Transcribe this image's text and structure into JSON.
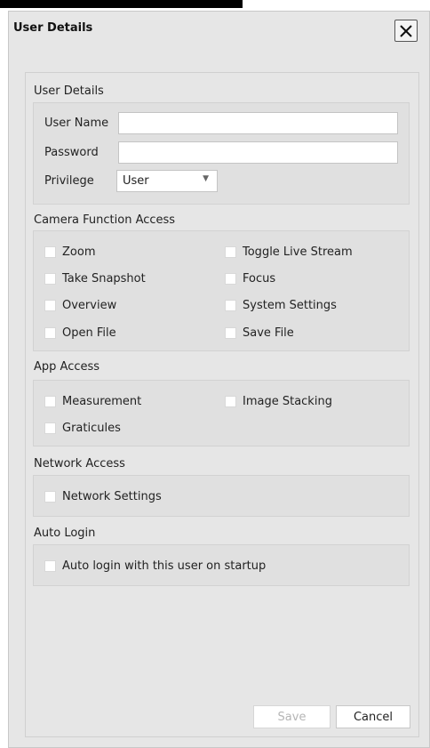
{
  "dialog": {
    "title": "User Details"
  },
  "user_details": {
    "section_label": "User Details",
    "username_label": "User Name",
    "username_value": "",
    "password_label": "Password",
    "password_value": "",
    "privilege_label": "Privilege",
    "privilege_value": "User"
  },
  "camera": {
    "section_label": "Camera Function Access",
    "items": [
      {
        "label": "Zoom",
        "checked": false
      },
      {
        "label": "Toggle Live Stream",
        "checked": false
      },
      {
        "label": "Take Snapshot",
        "checked": false
      },
      {
        "label": "Focus",
        "checked": false
      },
      {
        "label": "Overview",
        "checked": false
      },
      {
        "label": "System Settings",
        "checked": false
      },
      {
        "label": "Open File",
        "checked": false
      },
      {
        "label": "Save File",
        "checked": false
      }
    ]
  },
  "app": {
    "section_label": "App Access",
    "items": [
      {
        "label": "Measurement",
        "checked": false
      },
      {
        "label": "Image Stacking",
        "checked": false
      },
      {
        "label": "Graticules",
        "checked": false
      }
    ]
  },
  "network": {
    "section_label": "Network Access",
    "items": [
      {
        "label": "Network Settings",
        "checked": false
      }
    ]
  },
  "autologin": {
    "section_label": "Auto Login",
    "items": [
      {
        "label": "Auto login with this user on startup",
        "checked": false
      }
    ]
  },
  "buttons": {
    "save": "Save",
    "cancel": "Cancel"
  },
  "colors": {
    "dialog_bg": "#e6e6e6",
    "group_bg": "#e0e0e0",
    "disabled_text": "#b5b5b5"
  }
}
